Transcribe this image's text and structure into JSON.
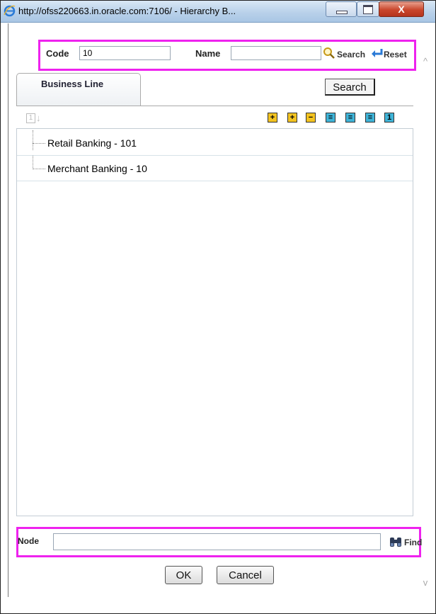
{
  "window": {
    "title": "http://ofss220663.in.oracle.com:7106/ - Hierarchy B...",
    "close_glyph": "X",
    "scroll_up_glyph": "^",
    "scroll_down_glyph": "v"
  },
  "filter": {
    "code_label": "Code",
    "code_value": "10",
    "name_label": "Name",
    "name_value": "",
    "search_label": "Search",
    "reset_label": "Reset"
  },
  "tabs": {
    "active_tab": "Business Line",
    "search_button": "Search"
  },
  "toolbar": {
    "sort_glyph": "1",
    "sort_arrow": "↓",
    "icons": [
      "expand-all-icon",
      "expand-branch-icon",
      "collapse-branch-icon",
      "show-code-icon",
      "show-name-icon",
      "show-both-icon",
      "level-one-icon"
    ],
    "level_label": "1"
  },
  "tree": {
    "nodes": [
      {
        "label": "Retail Banking - 101"
      },
      {
        "label": "Merchant Banking - 10"
      }
    ]
  },
  "find": {
    "node_label": "Node",
    "node_value": "",
    "find_label": "Find"
  },
  "dialog": {
    "ok_label": "OK",
    "cancel_label": "Cancel"
  },
  "colors": {
    "highlight": "#ee22ee",
    "toolbar_yellow": "#f3c320",
    "toolbar_blue": "#3fb4d8",
    "titlebar": "#b9d1ea"
  }
}
